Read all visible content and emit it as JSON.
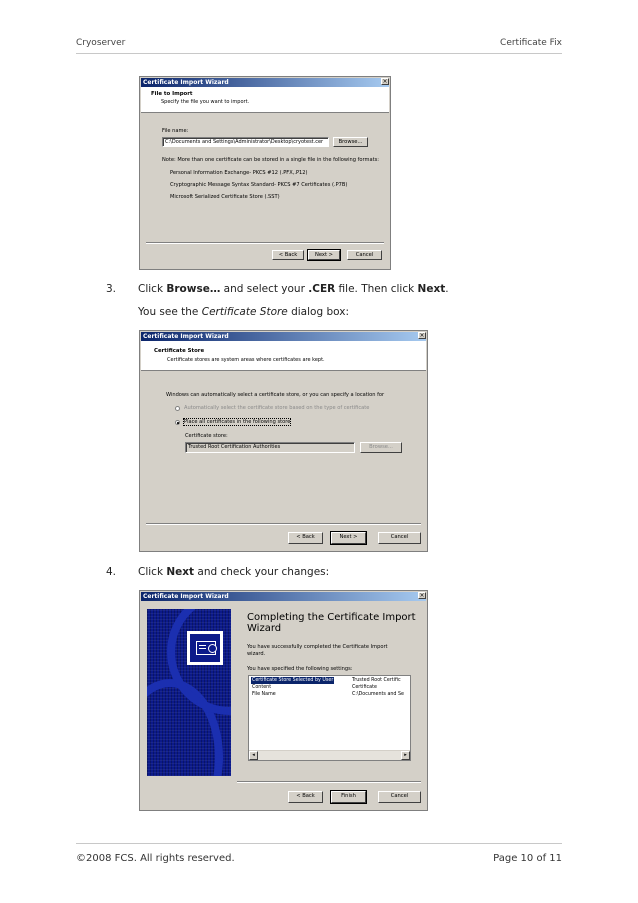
{
  "header": {
    "left": "Cryoserver",
    "right": "Certificate Fix"
  },
  "footer": {
    "left": "©2008 FCS. All rights reserved.",
    "right": "Page 10 of 11"
  },
  "icons": {
    "close": "close-icon",
    "radio": "radio-icon",
    "certificate": "certificate-icon",
    "scroll_left": "scroll-left-arrow-icon",
    "scroll_right": "scroll-right-arrow-icon"
  },
  "colors": {
    "titlebar_start": "#0a246a",
    "titlebar_end": "#a6caf0",
    "dialog_bg": "#d4d0c8",
    "banner": "#0c1a8a"
  },
  "dialog1": {
    "title": "Certificate Import Wizard",
    "close": "×",
    "section_title": "File to Import",
    "section_sub": "Specify the file you want to import.",
    "file_label": "File name:",
    "file_value": "C:\\Documents and Settings\\Administrator\\Desktop\\cryotest.cer",
    "browse": "Browse...",
    "note": "Note: More than one certificate can be stored in a single file in the following formats:",
    "formats": [
      "Personal Information Exchange- PKCS #12 (.PFX,.P12)",
      "Cryptographic Message Syntax Standard- PKCS #7 Certificates (.P7B)",
      "Microsoft Serialized Certificate Store (.SST)"
    ],
    "back": "< Back",
    "next": "Next >",
    "cancel": "Cancel"
  },
  "step3": {
    "number": "3.",
    "click": "Click ",
    "browse": "Browse…",
    "mid": " and select your  ",
    "cer": ".CER",
    "mid2": " file. Then click ",
    "next": "Next",
    "end": ".",
    "see_prefix": "You see the ",
    "see_italic": "Certificate Store",
    "see_suffix": " dialog box:"
  },
  "dialog2": {
    "title": "Certificate Import Wizard",
    "close": "×",
    "section_title": "Certificate Store",
    "section_sub": "Certificate stores are system areas where certificates are kept.",
    "description": "Windows can automatically select a certificate store, or you can specify a location for",
    "radio_auto": "Automatically select the certificate store based on the type of certificate",
    "radio_place": "Place all certificates in the following store",
    "store_label": "Certificate store:",
    "store_value": "Trusted Root Certification Authorities",
    "browse": "Browse...",
    "back": "< Back",
    "next": "Next >",
    "cancel": "Cancel"
  },
  "step4": {
    "number": "4.",
    "click": "Click ",
    "next": "Next",
    "rest": " and check your changes:"
  },
  "dialog3": {
    "title": "Certificate Import Wizard",
    "close": "×",
    "heading_line1": "Completing the Certificate Import",
    "heading_line2": "Wizard",
    "success_line1": "You have successfully completed the Certificate Import",
    "success_line2": "wizard.",
    "specified": "You have specified the following settings:",
    "rows": [
      {
        "key": "Certificate Store Selected by User",
        "value": "Trusted Root Certific"
      },
      {
        "key": "Content",
        "value": "Certificate"
      },
      {
        "key": "File Name",
        "value": "C:\\Documents and Se"
      }
    ],
    "scroll_left": "◂",
    "scroll_right": "▸",
    "back": "< Back",
    "finish": "Finish",
    "cancel": "Cancel"
  }
}
